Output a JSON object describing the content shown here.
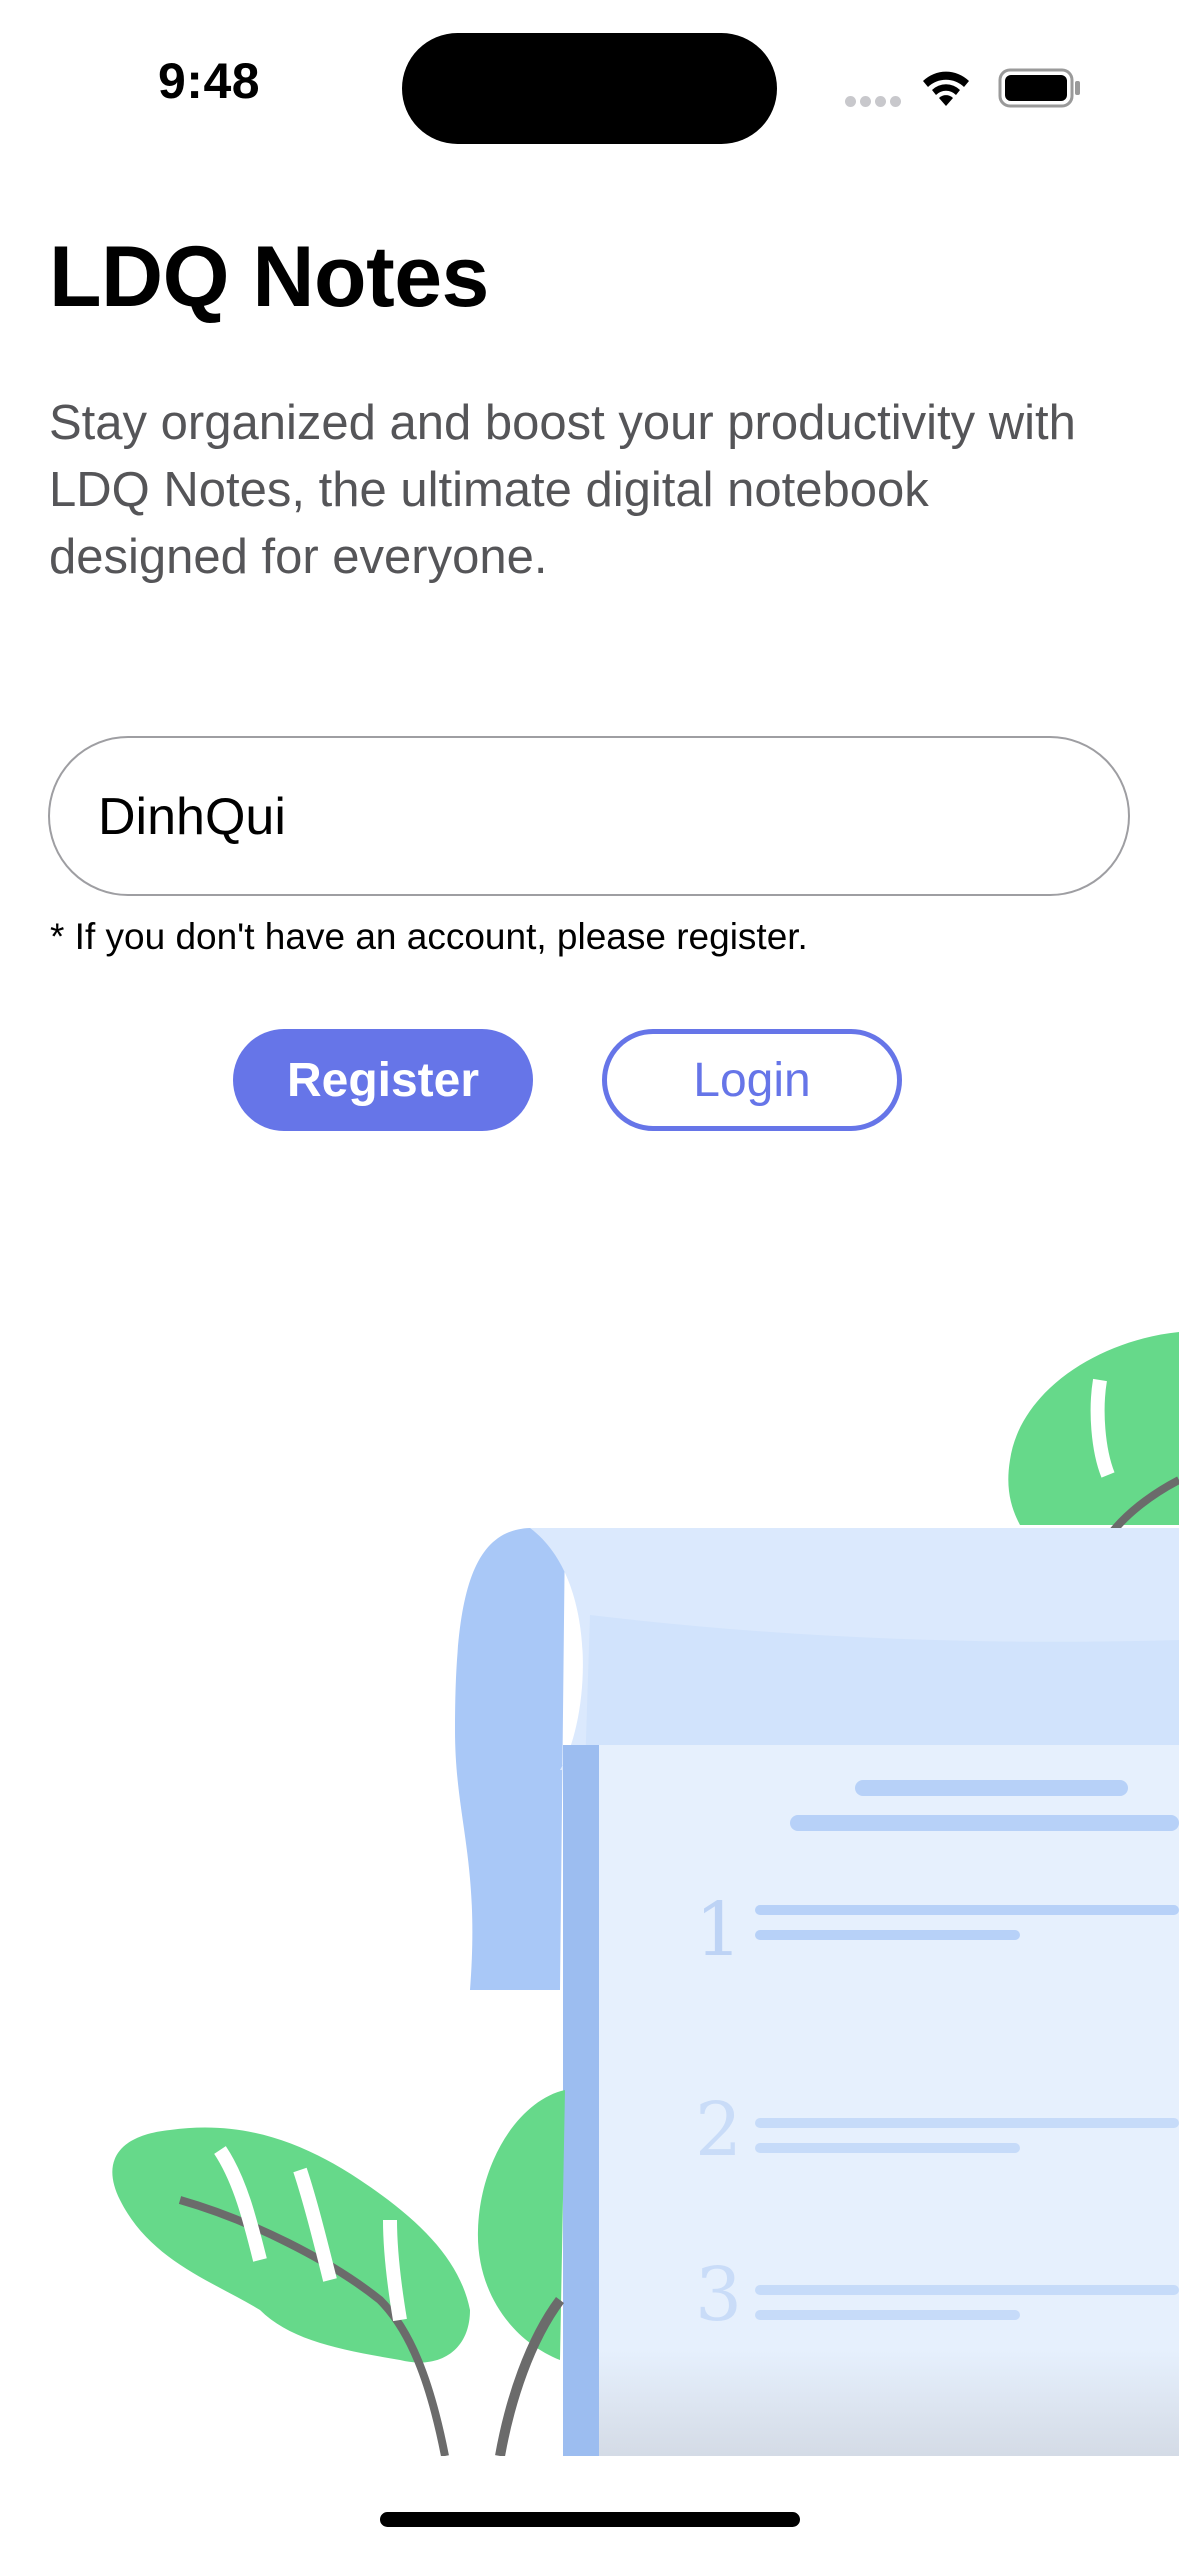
{
  "status_bar": {
    "time": "9:48",
    "icons": [
      "cellular-signal-icon",
      "wifi-icon",
      "battery-icon"
    ]
  },
  "app": {
    "title": "LDQ Notes",
    "subtitle": "Stay organized and boost your productivity with LDQ Notes, the ultimate digital notebook designed for everyone."
  },
  "form": {
    "username_value": "DinhQui",
    "hint": "* If you don't have an account, please register.",
    "register_label": "Register",
    "login_label": "Login"
  },
  "colors": {
    "accent": "#6675e8",
    "leaf": "#66d98a",
    "notebook": "#dbe9fd"
  }
}
